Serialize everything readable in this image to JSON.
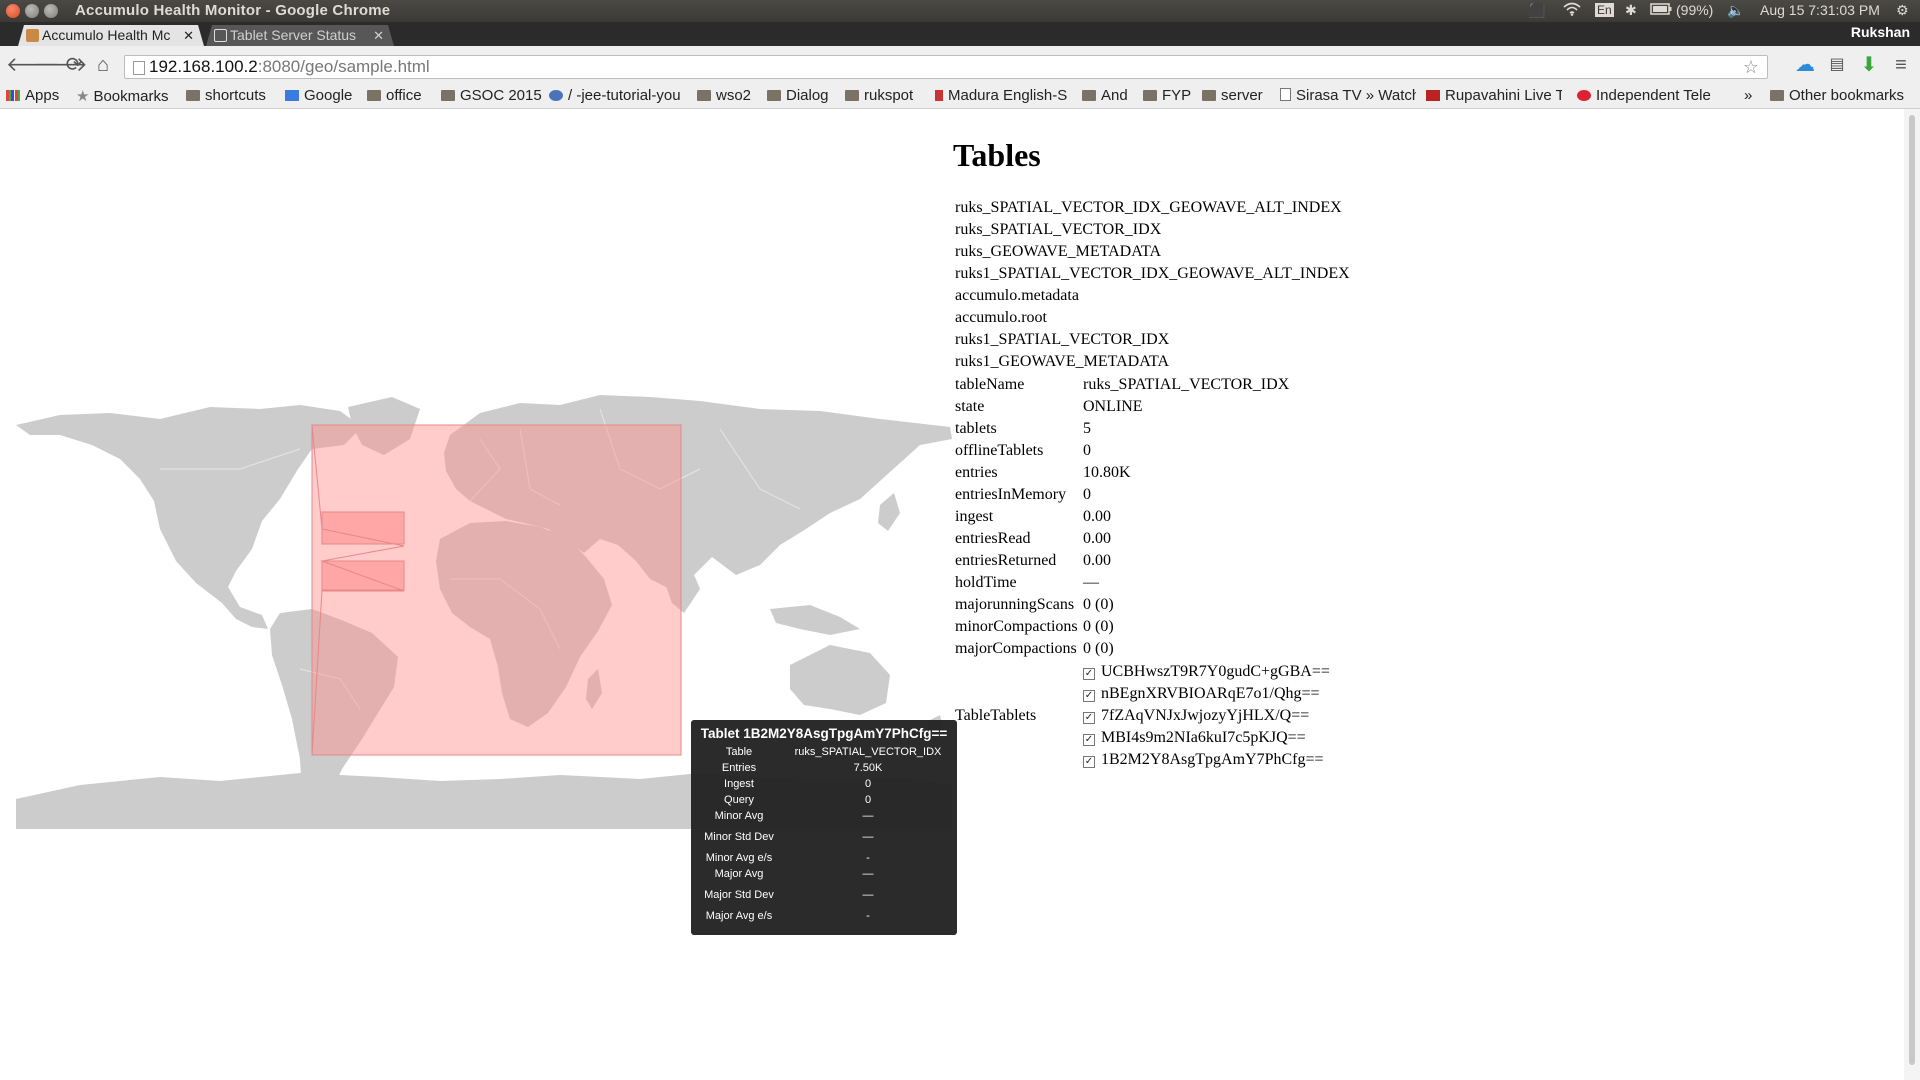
{
  "window": {
    "title": "Accumulo Health Monitor - Google Chrome",
    "tray": {
      "battery": "(99%)",
      "datetime": "Aug 15  7:31:03 PM",
      "keyboard": "En"
    }
  },
  "tabs": [
    {
      "label": "Accumulo Health Mc",
      "active": true
    },
    {
      "label": "Tablet Server Status",
      "active": false
    }
  ],
  "profile": {
    "user": "Rukshan"
  },
  "address_bar": {
    "host": "192.168.100.2",
    "path": ":8080/geo/sample.html"
  },
  "bookmarks": {
    "apps": "Apps",
    "items": [
      "Bookmarks",
      "shortcuts",
      "Google",
      "office",
      "GSOC 2015",
      "/ -jee-tutorial-you",
      "wso2",
      "Dialog",
      "rukspot",
      "Madura English-S",
      "And",
      "FYP",
      "server",
      "Sirasa TV » Watch",
      "Rupavahini Live T",
      "Independent Tele"
    ],
    "overflow": "»",
    "other": "Other bookmarks"
  },
  "map": {
    "land_color": "#cccccc",
    "border_color": "#e6e6e6",
    "bbox_fill": "#ff8b8b",
    "bbox_stroke": "#e58888"
  },
  "tables": {
    "heading": "Tables",
    "list": [
      "ruks_SPATIAL_VECTOR_IDX_GEOWAVE_ALT_INDEX",
      "ruks_SPATIAL_VECTOR_IDX",
      "ruks_GEOWAVE_METADATA",
      "ruks1_SPATIAL_VECTOR_IDX_GEOWAVE_ALT_INDEX",
      "accumulo.metadata",
      "accumulo.root",
      "ruks1_SPATIAL_VECTOR_IDX",
      "ruks1_GEOWAVE_METADATA"
    ]
  },
  "detail": {
    "rows": [
      {
        "key": "tableName",
        "value": "ruks_SPATIAL_VECTOR_IDX"
      },
      {
        "key": "state",
        "value": "ONLINE"
      },
      {
        "key": "tablets",
        "value": "5"
      },
      {
        "key": "offlineTablets",
        "value": "0"
      },
      {
        "key": "entries",
        "value": "10.80K"
      },
      {
        "key": "entriesInMemory",
        "value": "0"
      },
      {
        "key": "ingest",
        "value": "0.00"
      },
      {
        "key": "entriesRead",
        "value": "0.00"
      },
      {
        "key": "entriesReturned",
        "value": "0.00"
      },
      {
        "key": "holdTime",
        "value": "—"
      },
      {
        "key": "majorunningScans",
        "value": "0 (0)"
      },
      {
        "key": "minorCompactions",
        "value": "0 (0)"
      },
      {
        "key": "majorCompactions",
        "value": "0 (0)"
      }
    ],
    "tabletables_label": "TableTablets",
    "tablets": [
      {
        "id": "UCBHwszT9R7Y0gudC+gGBA==",
        "checked": true
      },
      {
        "id": "nBEgnXRVBIOARqE7o1/Qhg==",
        "checked": true
      },
      {
        "id": "7fZAqVNJxJwjozyYjHLX/Q==",
        "checked": true
      },
      {
        "id": "MBI4s9m2NIa6kuI7c5pKJQ==",
        "checked": true
      },
      {
        "id": "1B2M2Y8AsgTpgAmY7PhCfg==",
        "checked": true
      }
    ]
  },
  "tooltip": {
    "title": "Tablet 1B2M2Y8AsgTpgAmY7PhCfg==",
    "rows": [
      {
        "label": "Table",
        "value": "ruks_SPATIAL_VECTOR_IDX"
      },
      {
        "label": "Entries",
        "value": "7.50K"
      },
      {
        "label": "Ingest",
        "value": "0"
      },
      {
        "label": "Query",
        "value": "0"
      },
      {
        "label": "Minor Avg",
        "value": "—"
      },
      {
        "label": "Minor Std Dev",
        "value": "—"
      },
      {
        "label": "Minor Avg e/s",
        "value": "-"
      },
      {
        "label": "Major Avg",
        "value": "—"
      },
      {
        "label": "Major Std Dev",
        "value": "—"
      },
      {
        "label": "Major Avg e/s",
        "value": "-"
      }
    ]
  }
}
